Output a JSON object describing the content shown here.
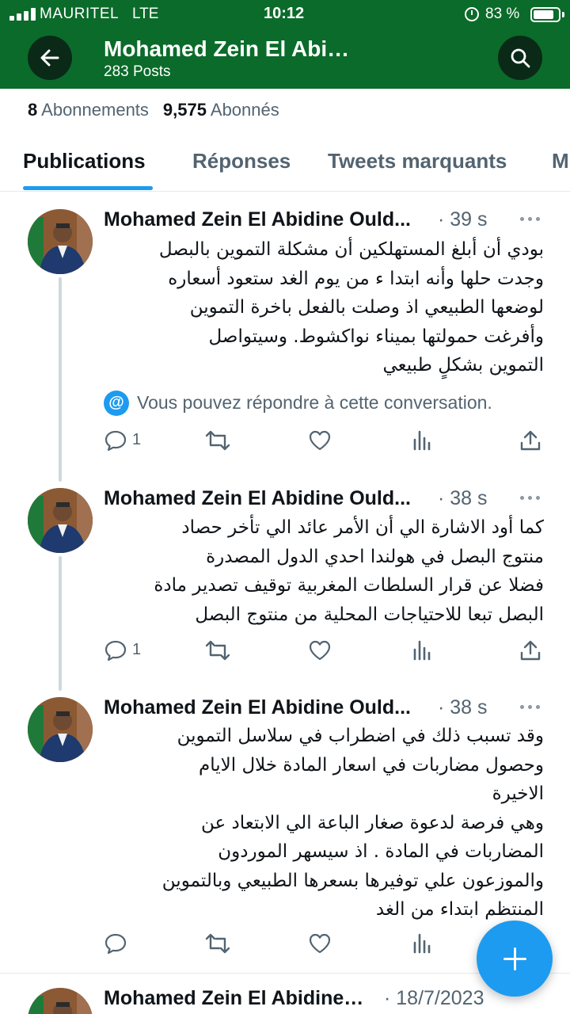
{
  "status_bar": {
    "carrier": "MAURITEL",
    "network": "LTE",
    "time": "10:12",
    "battery_pct": "83 %",
    "battery_level": 0.83,
    "signal_bars": 4
  },
  "header": {
    "title": "Mohamed Zein El Abi…",
    "subtitle": "283 Posts",
    "back_icon": "arrow-left-icon",
    "search_icon": "search-icon"
  },
  "profile": {
    "following_count": "8",
    "following_label": "Abonnements",
    "followers_count": "9,575",
    "followers_label": "Abonnés"
  },
  "tabs": [
    {
      "label": "Publications",
      "active": true
    },
    {
      "label": "Réponses",
      "active": false
    },
    {
      "label": "Tweets marquants",
      "active": false
    },
    {
      "label": "M",
      "active": false
    }
  ],
  "tweets": [
    {
      "author": "Mohamed Zein El Abidine Ould...",
      "time": "· 39 s",
      "text": "بودي أن أبلغ المستهلكين أن مشكلة التموين بالبصل\nوجدت حلها وأنه ابتدا ء من يوم الغد  ستعود أسعاره\nلوضعها الطبيعي اذ وصلت  بالفعل باخرة التموين\nوأفرغت حمولتها بميناء نواكشوط. وسيتواصل\nالتموين  بشكلٍ طبيعي",
      "notice": "Vous pouvez répondre à cette conversation.",
      "replies": "1"
    },
    {
      "author": "Mohamed Zein El Abidine Ould...",
      "time": "· 38 s",
      "text": "كما أود الاشارة الي أن الأمر عائد الي تأخر حصاد\nمنتوج البصل في هولندا احدي الدول المصدرة\nفضلا عن قرار السلطات المغربية توقيف تصدير مادة\nالبصل تبعا للاحتياجات المحلية من منتوج البصل",
      "replies": "1"
    },
    {
      "author": "Mohamed Zein El Abidine Ould...",
      "time": "· 38 s",
      "text": "وقد تسبب ذلك في اضطراب في سلاسل التموين\nوحصول مضاربات في اسعار المادة خلال الايام\nالاخيرة\nوهي فرصة لدعوة صغار الباعة الي الابتعاد عن\nالمضاربات  في المادة . اذ سيسهر  الموردون\nوالموزعون علي توفيرها بسعرها الطبيعي وبالتموين\nالمنتظم  ابتداء من الغد",
      "replies": ""
    },
    {
      "author": "Mohamed Zein El Abidine…",
      "time": "· 18/7/2023"
    }
  ],
  "colors": {
    "header_green": "#0b6b2a",
    "accent_blue": "#1d9bf0"
  }
}
